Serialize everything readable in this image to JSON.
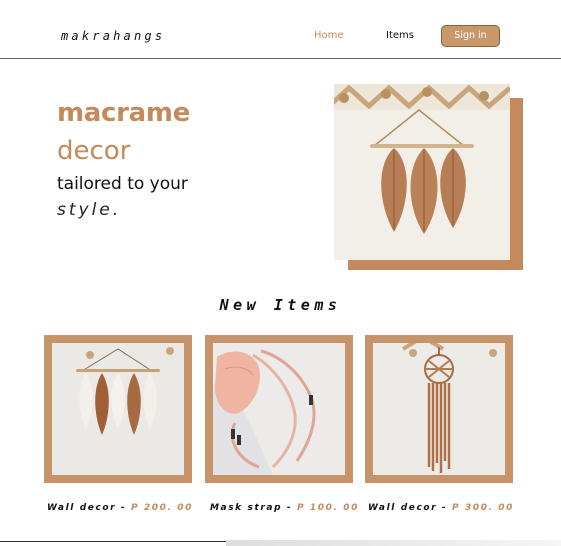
{
  "header": {
    "logo": "makrahangs",
    "nav": {
      "home": "Home",
      "items": "Items"
    },
    "signin_label": "Sign in"
  },
  "hero": {
    "line1": "macrame",
    "line2": "decor",
    "line3": "tailored to your",
    "line4": "style."
  },
  "section": {
    "title": "New Items"
  },
  "products": [
    {
      "name": "Wall decor",
      "separator": " - ",
      "price": "P 200. 00"
    },
    {
      "name": "Mask strap",
      "separator": " - ",
      "price": "P 100. 00"
    },
    {
      "name": "Wall decor",
      "separator": " - ",
      "price": "P 300. 00"
    }
  ],
  "colors": {
    "accent": "#c48a5c",
    "button": "#c8976a",
    "card_frame": "#c69468"
  }
}
